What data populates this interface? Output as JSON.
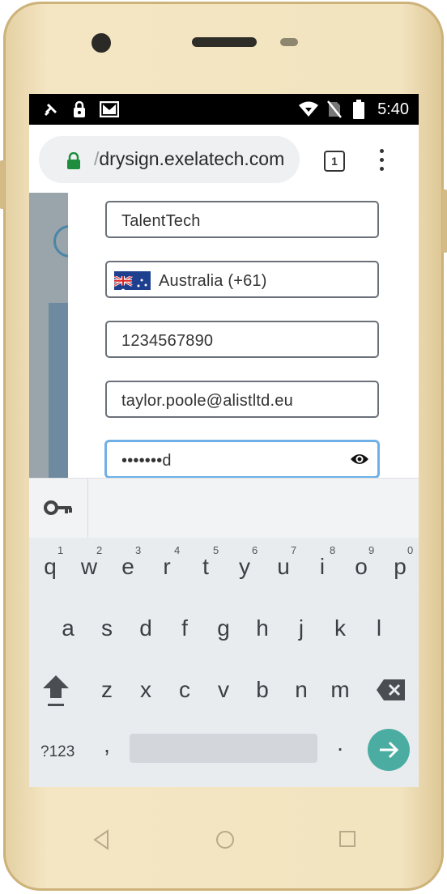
{
  "status_bar": {
    "time": "5:40",
    "left_icons": [
      "satellite-icon",
      "lock-icon",
      "gmail-icon"
    ],
    "right_icons": [
      "wifi-icon",
      "no-sim-icon",
      "battery-icon"
    ]
  },
  "browser": {
    "url_prefix": "/",
    "url_domain": "drysign.exelatech.com",
    "tab_count": "1"
  },
  "form": {
    "company": "TalentTech",
    "country": "Australia (+61)",
    "phone": "1234567890",
    "email": "taylor.poole@alistltd.eu",
    "password_masked": "•••••••d"
  },
  "keyboard": {
    "row1": [
      "q",
      "w",
      "e",
      "r",
      "t",
      "y",
      "u",
      "i",
      "o",
      "p"
    ],
    "row1_numbers": [
      "1",
      "2",
      "3",
      "4",
      "5",
      "6",
      "7",
      "8",
      "9",
      "0"
    ],
    "row2": [
      "a",
      "s",
      "d",
      "f",
      "g",
      "h",
      "j",
      "k",
      "l"
    ],
    "row3": [
      "z",
      "x",
      "c",
      "v",
      "b",
      "n",
      "m"
    ],
    "symbols_label": "?123",
    "comma": ",",
    "period": "."
  },
  "colors": {
    "accent": "#4bada2",
    "field_focus": "#6fb1e6",
    "lock_green": "#1e8e3e"
  }
}
